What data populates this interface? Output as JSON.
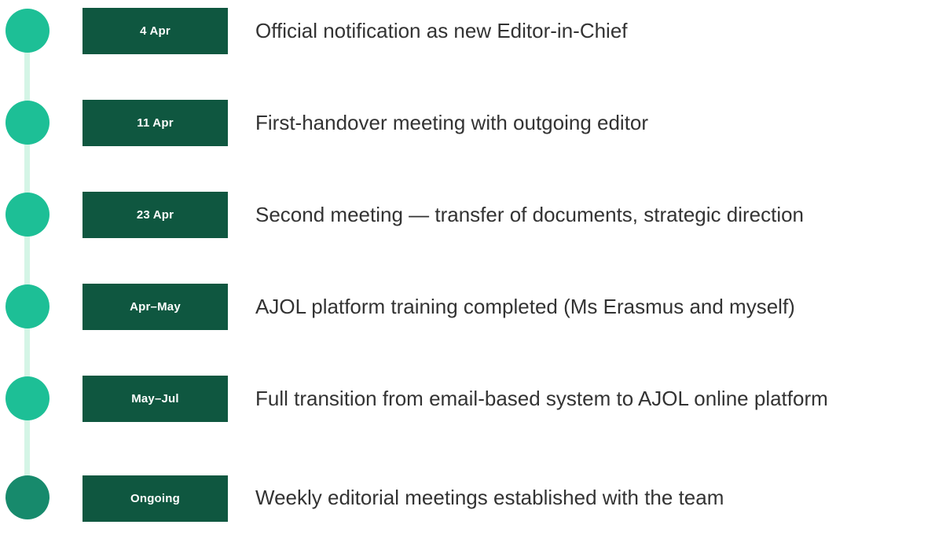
{
  "timeline": {
    "items": [
      {
        "date": "4 Apr",
        "text": "Official notification as new Editor-in-Chief"
      },
      {
        "date": "11 Apr",
        "text": "First-handover meeting with outgoing editor"
      },
      {
        "date": "23 Apr",
        "text": "Second meeting — transfer of documents, strategic direction"
      },
      {
        "date": "Apr–May",
        "text": "AJOL platform training completed (Ms Erasmus and myself)"
      },
      {
        "date": "May–Jul",
        "text": "Full transition from email-based system to AJOL online platform"
      },
      {
        "date": "Ongoing",
        "text": "Weekly editorial meetings established with the team"
      }
    ],
    "colors": {
      "dot": "#1dbf96",
      "dot_last": "#178a6c",
      "spine": "#d4f5e6",
      "date_box": "#0f5740",
      "text": "#333333"
    }
  }
}
